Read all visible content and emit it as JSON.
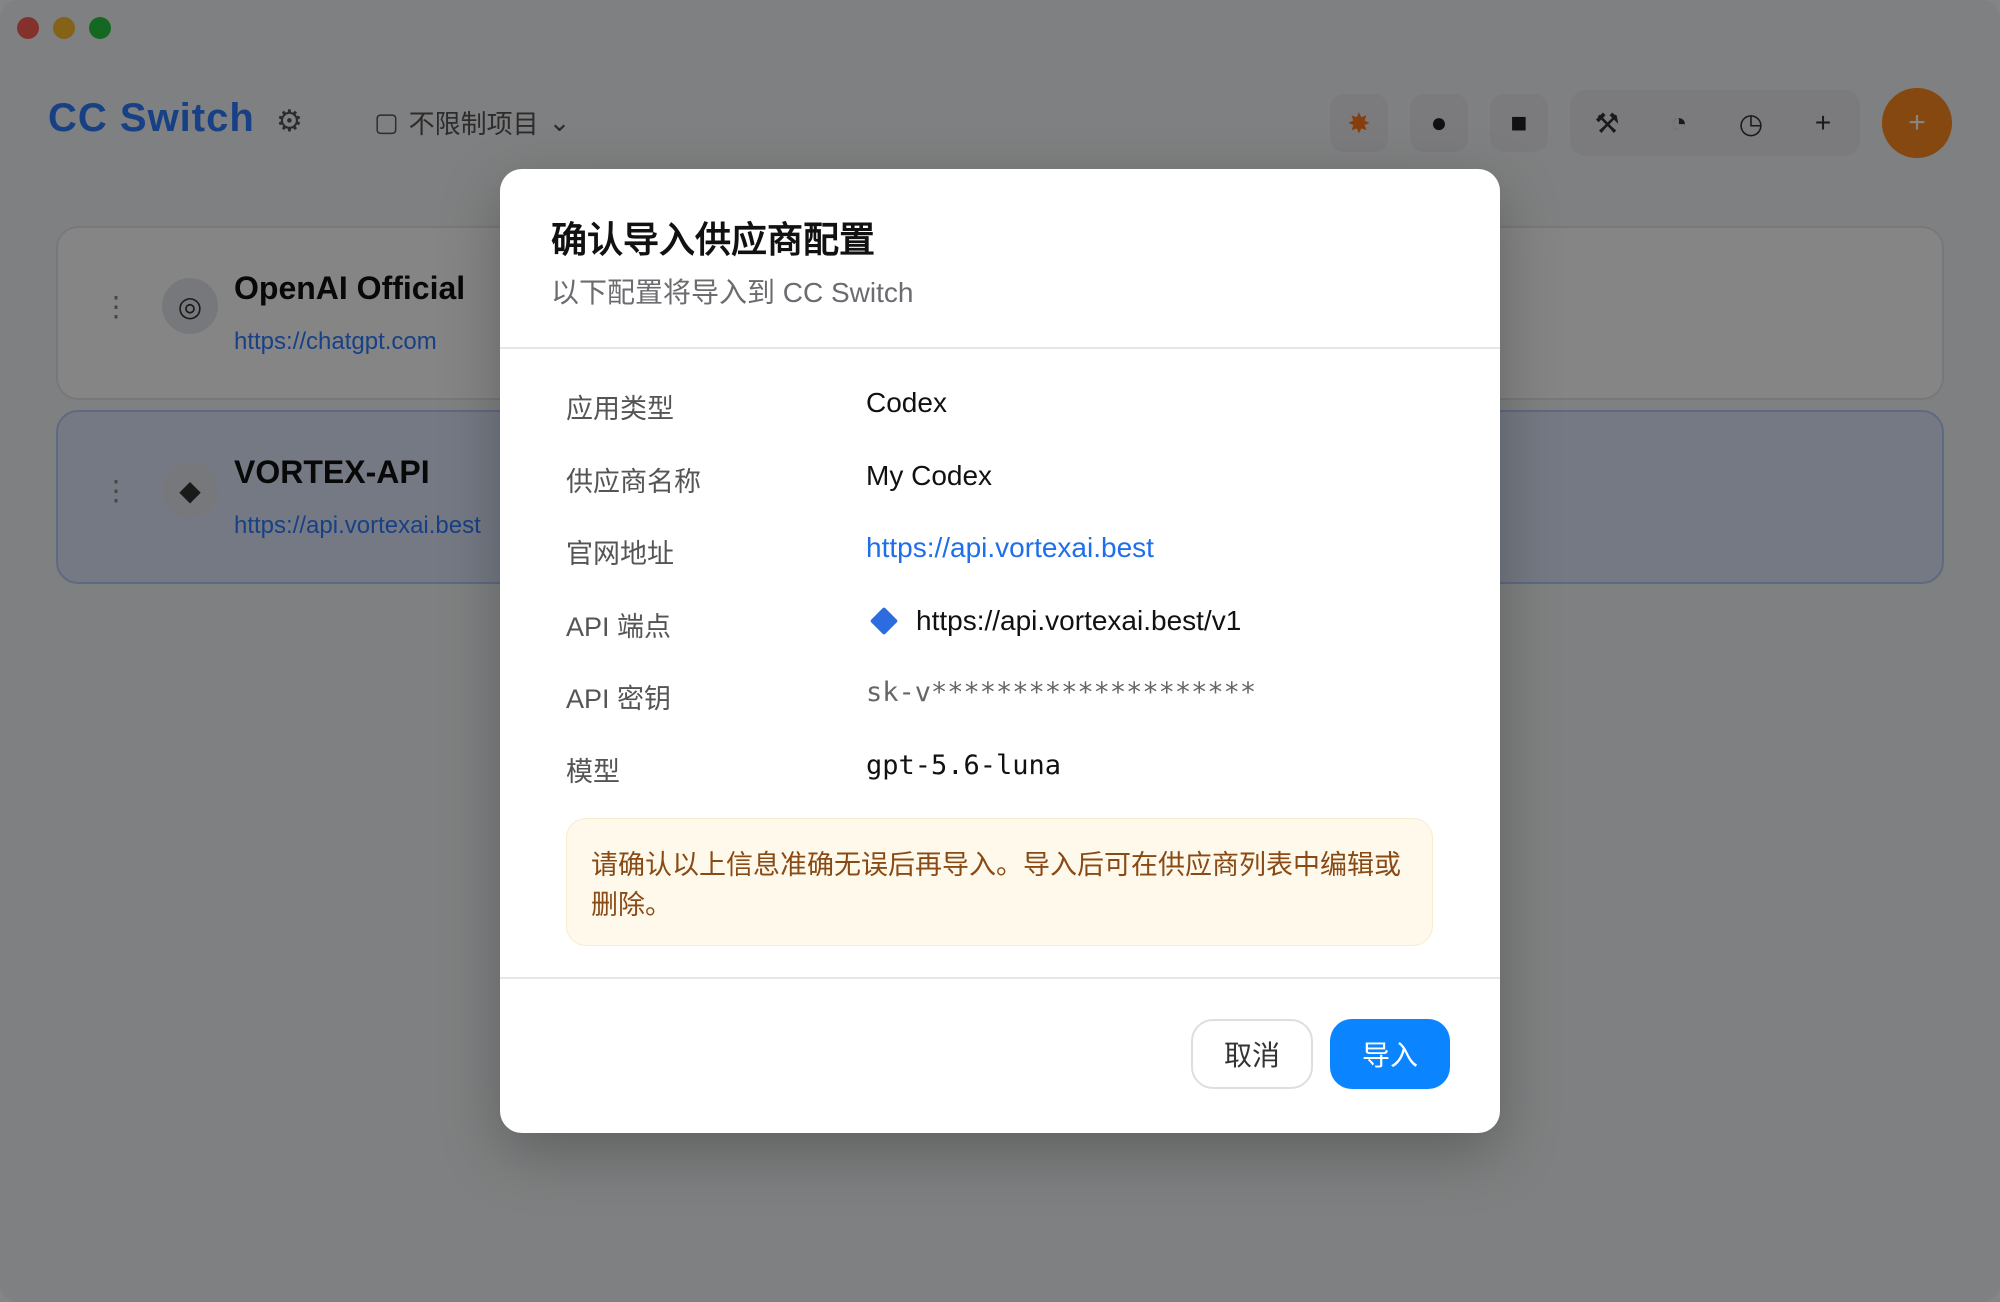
{
  "app": {
    "brand": "CC Switch",
    "mode_label": "不限制项目",
    "providers": [
      {
        "name": "OpenAI Official",
        "url": "https://chatgpt.com"
      },
      {
        "name": "VORTEX-API",
        "url": "https://api.vortexai.best"
      }
    ]
  },
  "dialog": {
    "title": "确认导入供应商配置",
    "subtitle": "以下配置将导入到 CC Switch",
    "rows": [
      {
        "label": "应用类型",
        "value": "Codex"
      },
      {
        "label": "供应商名称",
        "value": "My Codex"
      },
      {
        "label": "官网地址",
        "value": "https://api.vortexai.best"
      },
      {
        "label": "API 端点",
        "value": "https://api.vortexai.best/v1"
      },
      {
        "label": "API 密钥",
        "value": "sk-v********************"
      },
      {
        "label": "模型",
        "value": "gpt-5.6-luna"
      }
    ],
    "notice": "请确认以上信息准确无误后再导入。导入后可在供应商列表中编辑或删除。",
    "cancel_label": "取消",
    "import_label": "导入"
  },
  "colors": {
    "accent": "#0a84ff",
    "link": "#1f6feb",
    "notice_bg": "#fef9ea",
    "notice_text": "#8a4a16"
  }
}
